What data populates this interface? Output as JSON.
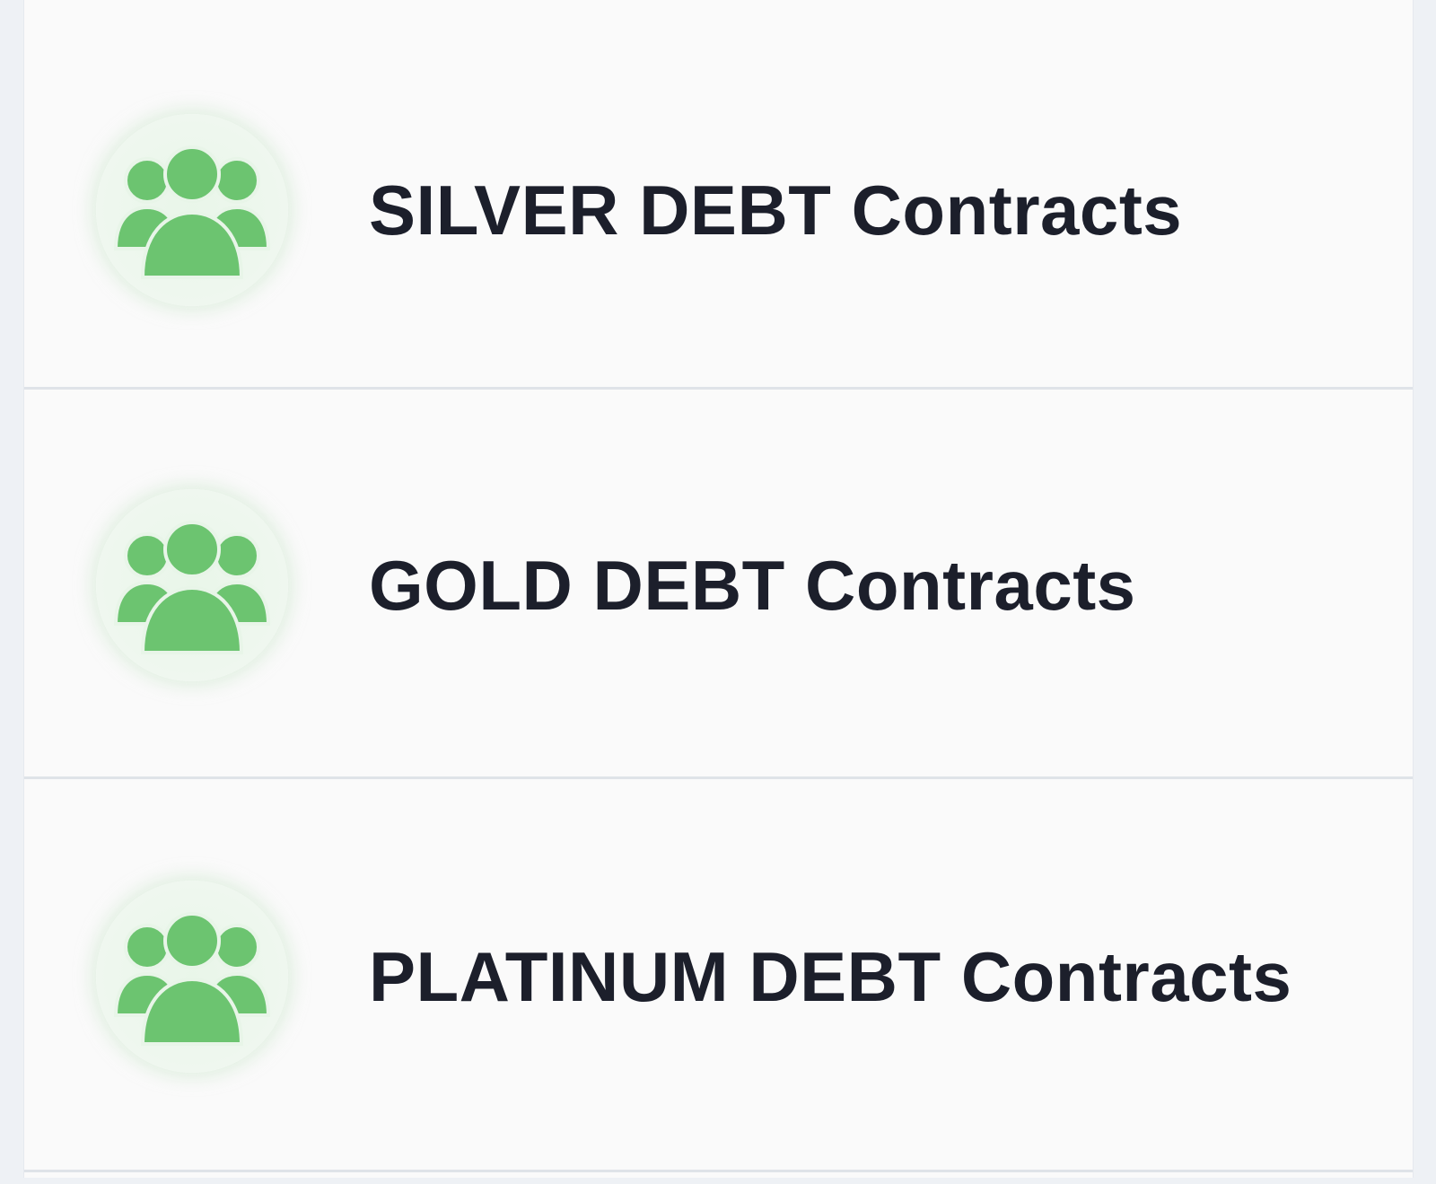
{
  "contracts": {
    "items": [
      {
        "label": "SILVER DEBT Contracts",
        "icon": "users-group-icon"
      },
      {
        "label": "GOLD DEBT Contracts",
        "icon": "users-group-icon"
      },
      {
        "label": "PLATINUM DEBT Contracts",
        "icon": "users-group-icon"
      }
    ],
    "icon_color": "#6cc470"
  }
}
